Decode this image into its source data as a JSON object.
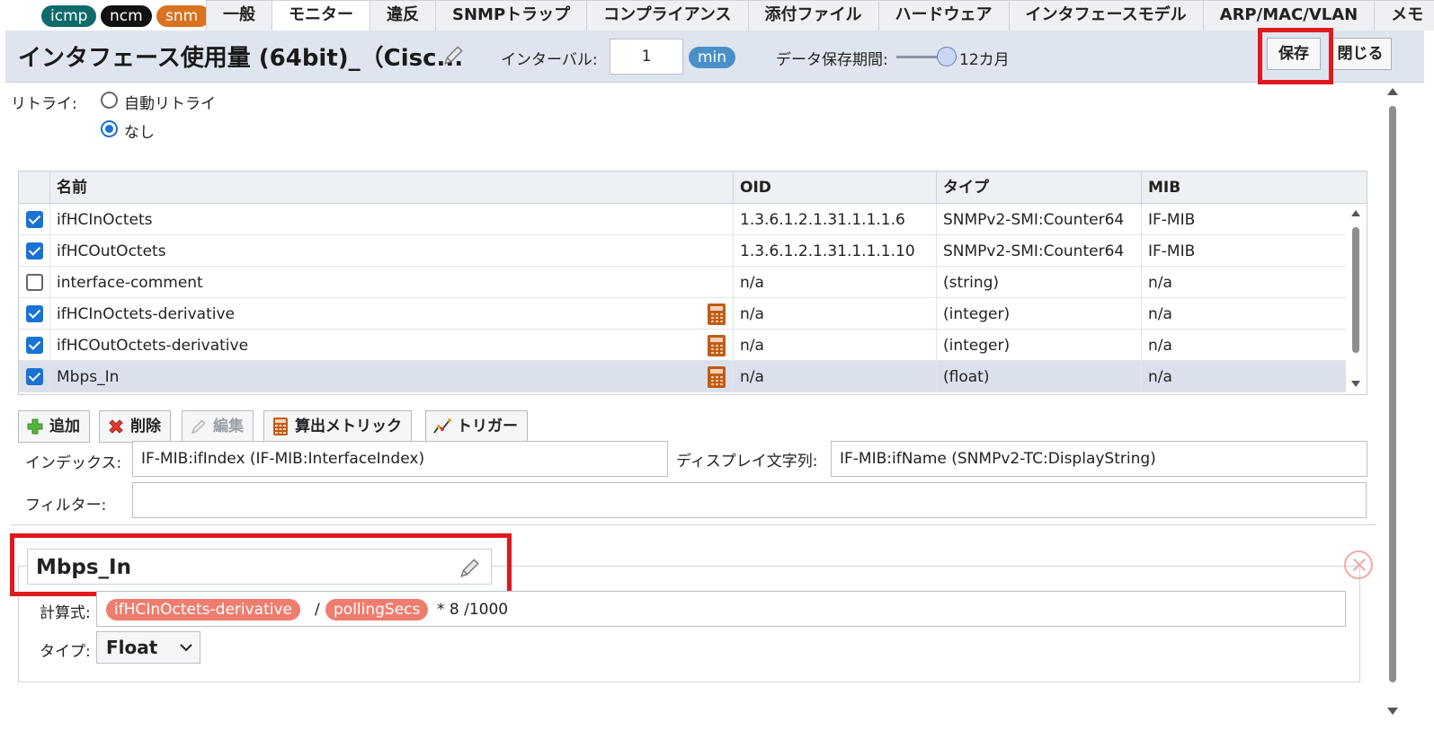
{
  "pills": [
    {
      "label": "icmp",
      "color": "#0f6b6b"
    },
    {
      "label": "ncm",
      "color": "#111111"
    },
    {
      "label": "snm",
      "color": "#d9731f"
    }
  ],
  "tabs": [
    "一般",
    "モニター",
    "違反",
    "SNMPトラップ",
    "コンプライアンス",
    "添付ファイル",
    "ハードウェア",
    "インタフェースモデル",
    "ARP/MAC/VLAN",
    "メモ"
  ],
  "active_tab": "モニター",
  "header": {
    "title": "インタフェース使用量 (64bit)_（Cisc...",
    "interval_label": "インターバル:",
    "interval_value": "1",
    "interval_unit": "min",
    "retention_label": "データ保存期間:",
    "retention_value": "12カ月",
    "save_label": "保存",
    "close_label": "閉じる"
  },
  "retry": {
    "label": "リトライ:",
    "options": [
      "自動リトライ",
      "なし"
    ],
    "selected": "なし"
  },
  "table": {
    "headers": [
      "名前",
      "OID",
      "タイプ",
      "MIB"
    ],
    "rows": [
      {
        "checked": true,
        "name": "ifHCInOctets",
        "oid": "1.3.6.1.2.1.31.1.1.1.6",
        "type": "SNMPv2-SMI:Counter64",
        "mib": "IF-MIB",
        "calc": false
      },
      {
        "checked": true,
        "name": "ifHCOutOctets",
        "oid": "1.3.6.1.2.1.31.1.1.1.10",
        "type": "SNMPv2-SMI:Counter64",
        "mib": "IF-MIB",
        "calc": false
      },
      {
        "checked": false,
        "name": "interface-comment",
        "oid": "n/a",
        "type": "(string)",
        "mib": "n/a",
        "calc": false
      },
      {
        "checked": true,
        "name": "ifHCInOctets-derivative",
        "oid": "n/a",
        "type": "(integer)",
        "mib": "n/a",
        "calc": true
      },
      {
        "checked": true,
        "name": "ifHCOutOctets-derivative",
        "oid": "n/a",
        "type": "(integer)",
        "mib": "n/a",
        "calc": true
      },
      {
        "checked": true,
        "name": "Mbps_In",
        "oid": "n/a",
        "type": "(float)",
        "mib": "n/a",
        "calc": true,
        "selected": true
      }
    ]
  },
  "toolbar": {
    "add": "追加",
    "delete": "削除",
    "edit": "編集",
    "calc_metric": "算出メトリック",
    "trigger": "トリガー"
  },
  "fields": {
    "index_label": "インデックス:",
    "index_value": "IF-MIB:ifIndex (IF-MIB:InterfaceIndex)",
    "display_label": "ディスプレイ文字列:",
    "display_value": "IF-MIB:ifName (SNMPv2-TC:DisplayString)",
    "filter_label": "フィルター:",
    "filter_value": ""
  },
  "metric": {
    "name": "Mbps_In",
    "formula_label": "計算式:",
    "token1": "ifHCInOctets-derivative",
    "op1": "/",
    "token2": "pollingSecs",
    "rest": "* 8 /1000",
    "type_label": "タイプ:",
    "type_value": "Float"
  },
  "colors": {
    "highlight": "#e0191e",
    "accent": "#1873d3",
    "token": "#ee7d6f"
  }
}
